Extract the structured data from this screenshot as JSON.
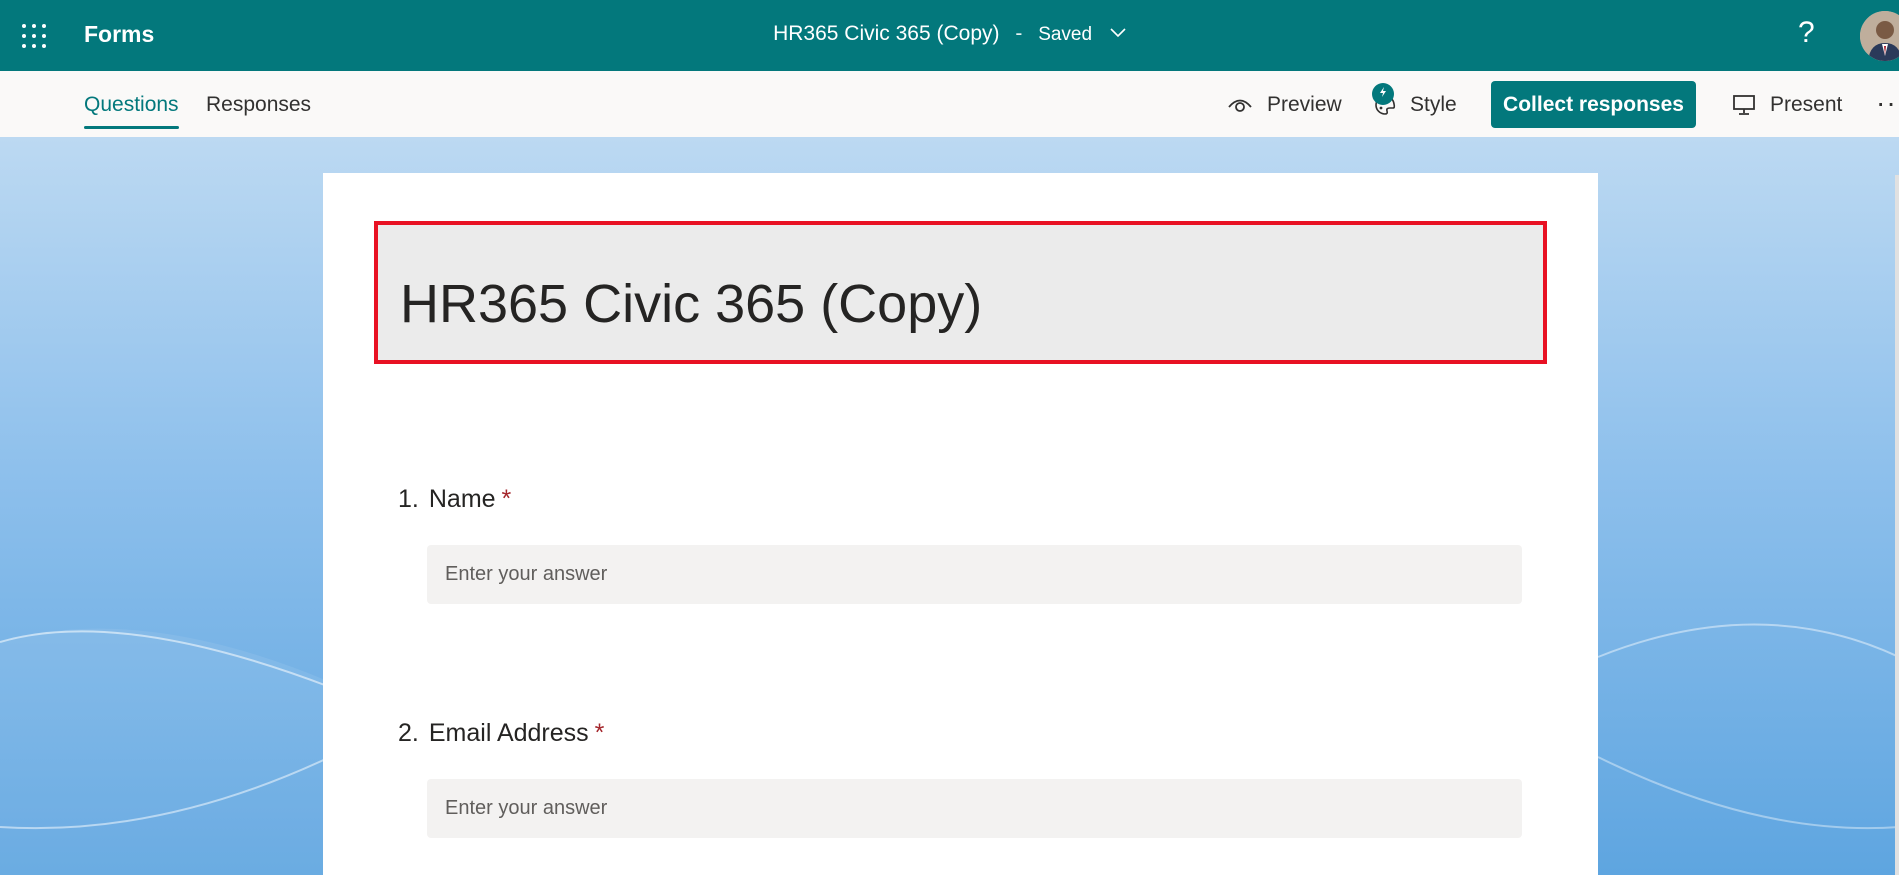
{
  "appbar": {
    "app_name": "Forms",
    "doc_title": "HR365 Civic 365 (Copy)",
    "separator": "-",
    "status": "Saved",
    "help": "?"
  },
  "cmdbar": {
    "tabs": [
      {
        "label": "Questions",
        "active": true
      },
      {
        "label": "Responses",
        "active": false
      }
    ],
    "preview_label": "Preview",
    "style_label": "Style",
    "collect_label": "Collect responses",
    "present_label": "Present",
    "more": "···"
  },
  "form": {
    "title": "HR365 Civic 365 (Copy)",
    "questions": [
      {
        "number": "1.",
        "label": "Name",
        "required": "*",
        "placeholder": "Enter your answer"
      },
      {
        "number": "2.",
        "label": "Email Address",
        "required": "*",
        "placeholder": "Enter your answer"
      }
    ]
  },
  "colors": {
    "brand": "#03787c",
    "highlight_border": "#e81123",
    "required": "#a4262c"
  },
  "icons": {
    "apps": "waffle-icon",
    "preview": "eye-icon",
    "style": "palette-icon",
    "present": "monitor-icon",
    "status": "chevron-down-icon"
  }
}
